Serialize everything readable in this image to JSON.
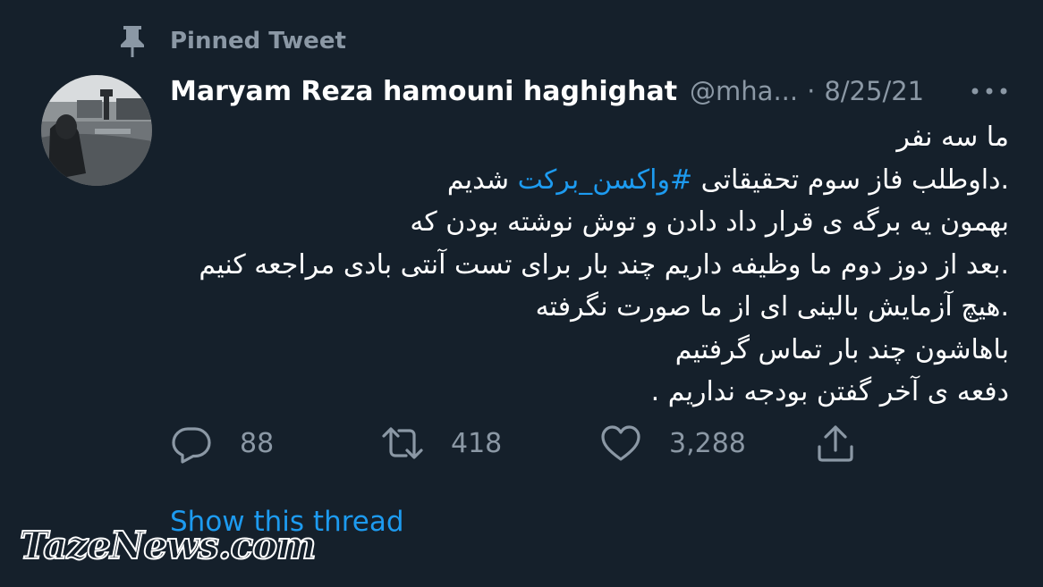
{
  "pinned": {
    "label": "Pinned Tweet",
    "icon": "pin-icon"
  },
  "tweet": {
    "display_name": "Maryam Reza hamouni haghighat",
    "handle": "@mha...",
    "separator": "·",
    "date": "8/25/21",
    "lines": [
      {
        "text": "ما سه نفر"
      },
      {
        "before": ".داوطلب فاز سوم تحقیقاتی ",
        "hashtag": "#واکسن_برکت",
        "after": " شدیم"
      },
      {
        "text": "بهمون یه برگه ی قرار داد دادن و توش نوشته بودن که"
      },
      {
        "text": ".بعد از دوز دوم ما وظیفه داریم چند بار برای تست آنتی بادی مراجعه کنیم"
      },
      {
        "text": ".هیچ آزمایش بالینی ای از ما صورت نگرفته"
      },
      {
        "text": "باهاشون چند بار تماس گرفتیم"
      },
      {
        "text": "دفعه ی آخر گفتن بودجه نداریم ."
      }
    ],
    "actions": {
      "replies": "88",
      "retweets": "418",
      "likes": "3,288"
    },
    "show_thread": "Show this thread"
  },
  "watermark": "TazeNews.com",
  "colors": {
    "background": "#15202b",
    "accent": "#1d9bf0",
    "muted": "#8b98a5",
    "text": "#ffffff"
  }
}
